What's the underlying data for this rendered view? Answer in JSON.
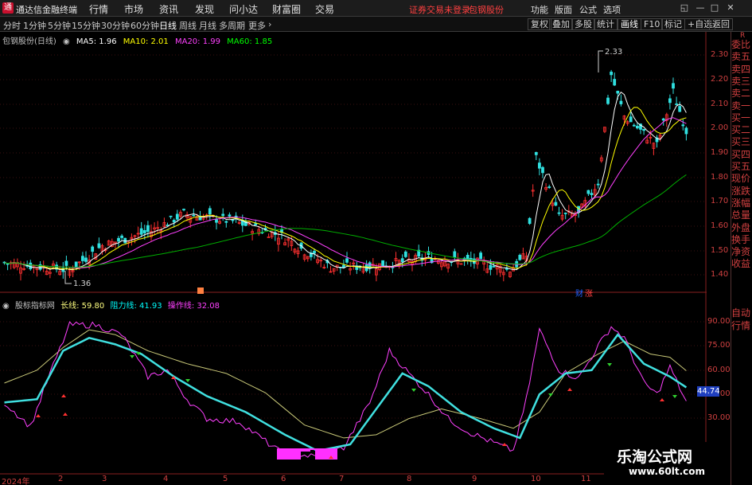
{
  "titlebar": {
    "app_name": "通达信金融终端",
    "menus": [
      "行情",
      "市场",
      "资讯",
      "发现",
      "问小达",
      "财富圈",
      "交易"
    ],
    "status_message": "证券交易未登录",
    "stock_title": "包钢股份",
    "right_menus": [
      "功能",
      "版面",
      "公式",
      "选项"
    ]
  },
  "toolbar": {
    "periods": [
      "分时",
      "1分钟",
      "5分钟",
      "15分钟",
      "30分钟",
      "60分钟",
      "日线",
      "周线",
      "月线",
      "多周期",
      "更多"
    ],
    "active_period": "日线",
    "right_tools": [
      "复权",
      "叠加",
      "多股",
      "统计",
      "画线",
      "F10",
      "标记",
      "+自选",
      "返回"
    ]
  },
  "price_panel": {
    "stock_label": "包钢股份(日线)",
    "ma": [
      {
        "label": "MA5: 1.96",
        "color": "#ffffff"
      },
      {
        "label": "MA10: 2.01",
        "color": "#ffff00"
      },
      {
        "label": "MA20: 1.99",
        "color": "#ff40ff"
      },
      {
        "label": "MA60: 1.85",
        "color": "#00ff00"
      }
    ],
    "high_label": "2.33",
    "low_label": "1.36",
    "price_ticks": [
      "2.30",
      "2.20",
      "2.10",
      "2.00",
      "1.90",
      "1.80",
      "1.70",
      "1.60",
      "1.50",
      "1.40"
    ],
    "finance_marker": "财",
    "rise_marker": "涨"
  },
  "indicator_panel": {
    "name": "股标指标网",
    "lines": [
      {
        "label": "长线: 59.80",
        "color": "#ffff80"
      },
      {
        "label": "阻力线: 41.93",
        "color": "#00ffff"
      },
      {
        "label": "操作线: 32.08",
        "color": "#ff40ff"
      }
    ],
    "ticks": [
      "90.00",
      "75.00",
      "60.00",
      "45.00",
      "30.00"
    ],
    "current_value": "44.74"
  },
  "dates": [
    "2024年",
    "2",
    "3",
    "4",
    "5",
    "6",
    "7",
    "8",
    "9",
    "10",
    "11"
  ],
  "sidebar": {
    "tabs": [
      "委比",
      "卖五",
      "卖四",
      "卖三",
      "卖二",
      "卖一",
      "买一",
      "买二",
      "买三",
      "买四",
      "买五",
      "现价",
      "涨跌",
      "涨幅",
      "总量",
      "外盘",
      "换手",
      "净资",
      "收益"
    ],
    "bottom_tabs": [
      "自动",
      "行情"
    ],
    "top_icon": "R"
  },
  "watermark": {
    "title": "乐淘公式网",
    "url": "www.60lt.com"
  },
  "colors": {
    "up": "#ff3030",
    "down": "#30e0e0",
    "ma60": "#00b000",
    "axis": "#d04040"
  }
}
